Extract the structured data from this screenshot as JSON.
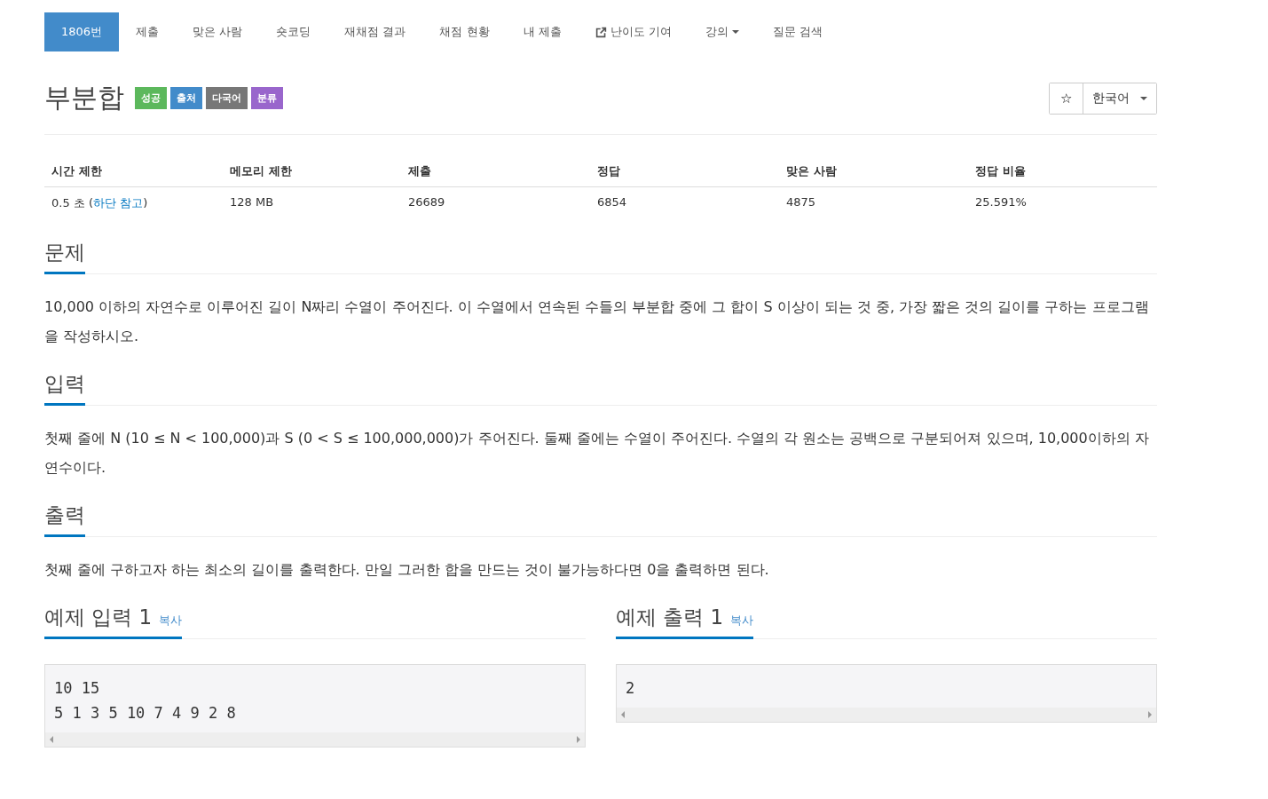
{
  "nav": [
    {
      "label": "1806번",
      "kind": "link",
      "selected": true
    },
    {
      "label": "제출",
      "kind": "link",
      "selected": false
    },
    {
      "label": "맞은 사람",
      "kind": "link",
      "selected": false
    },
    {
      "label": "숏코딩",
      "kind": "link",
      "selected": false
    },
    {
      "label": "재채점 결과",
      "kind": "link",
      "selected": false
    },
    {
      "label": "채점 현황",
      "kind": "link",
      "selected": false
    },
    {
      "label": "내 제출",
      "kind": "link",
      "selected": false
    },
    {
      "label": "난이도 기여",
      "kind": "external",
      "selected": false
    },
    {
      "label": "강의",
      "kind": "dropdown",
      "selected": false
    },
    {
      "label": "질문 검색",
      "kind": "link",
      "selected": false
    }
  ],
  "problem": {
    "title": "부분합",
    "labels": [
      {
        "text": "성공",
        "color": "#5cb85c"
      },
      {
        "text": "출처",
        "color": "#428bca"
      },
      {
        "text": "다국어",
        "color": "#777777"
      },
      {
        "text": "분류",
        "color": "#9966cc"
      }
    ],
    "star": "☆",
    "language": "한국어"
  },
  "info_table": {
    "columns": [
      "시간 제한",
      "메모리 제한",
      "제출",
      "정답",
      "맞은 사람",
      "정답 비율"
    ],
    "row": [
      {
        "text": "0.5 초 (",
        "link": "하단 참고",
        "suffix": ")"
      },
      {
        "text": "128 MB"
      },
      {
        "text": "26689"
      },
      {
        "text": "6854"
      },
      {
        "text": "4875"
      },
      {
        "text": "25.591%"
      }
    ]
  },
  "sections": [
    {
      "heading": "문제",
      "body": "10,000 이하의 자연수로 이루어진 길이 N짜리 수열이 주어진다. 이 수열에서 연속된 수들의 부분합 중에 그 합이 S 이상이 되는 것 중, 가장 짧은 것의 길이를 구하는 프로그램을 작성하시오."
    },
    {
      "heading": "입력",
      "body": "첫째 줄에 N (10 ≤ N < 100,000)과 S (0 < S ≤ 100,000,000)가 주어진다. 둘째 줄에는 수열이 주어진다. 수열의 각 원소는 공백으로 구분되어져 있으며, 10,000이하의 자연수이다."
    },
    {
      "heading": "출력",
      "body": "첫째 줄에 구하고자 하는 최소의 길이를 출력한다. 만일 그러한 합을 만드는 것이 불가능하다면 0을 출력하면 된다."
    }
  ],
  "samples": [
    {
      "heading": "예제 입력 1",
      "copy": "복사",
      "lines": [
        "10 15",
        "5 1 3 5 10 7 4 9 2 8"
      ]
    },
    {
      "heading": "예제 출력 1",
      "copy": "복사",
      "lines": [
        "2"
      ]
    }
  ]
}
